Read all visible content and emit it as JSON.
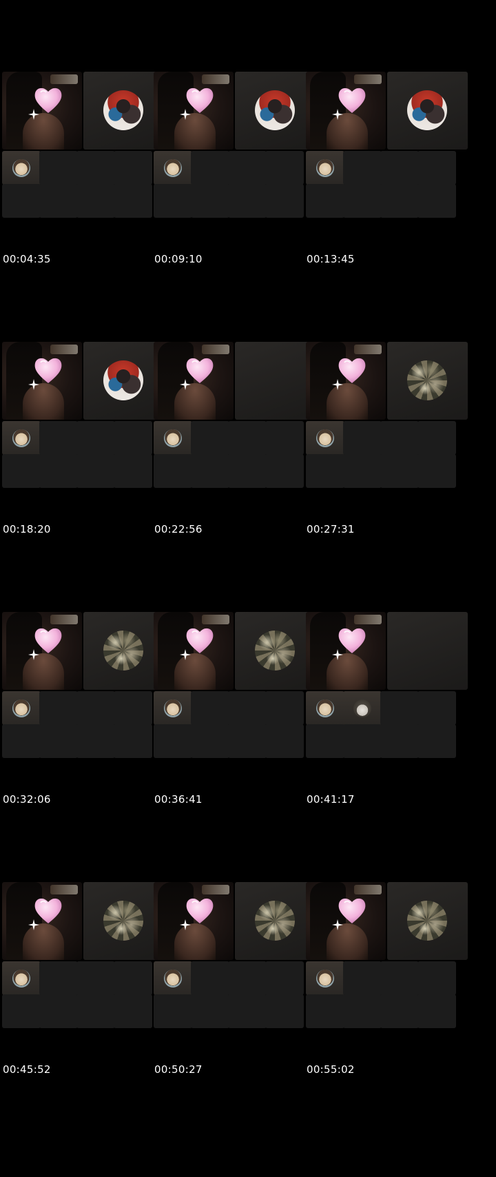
{
  "sheet": {
    "timestamps": [
      "00:04:35",
      "00:09:10",
      "00:13:45",
      "00:18:20",
      "00:22:56",
      "00:27:31",
      "00:32:06",
      "00:36:41",
      "00:41:17",
      "00:45:52",
      "00:50:27",
      "00:55:02"
    ],
    "frames": [
      {
        "guest_avatar": "red-jacket-avatar",
        "extra_seat_avatar": ""
      },
      {
        "guest_avatar": "red-jacket-avatar",
        "extra_seat_avatar": ""
      },
      {
        "guest_avatar": "red-jacket-avatar",
        "extra_seat_avatar": ""
      },
      {
        "guest_avatar": "red-jacket-avatar",
        "extra_seat_avatar": ""
      },
      {
        "guest_avatar": "",
        "extra_seat_avatar": ""
      },
      {
        "guest_avatar": "moss-pattern-avatar",
        "extra_seat_avatar": ""
      },
      {
        "guest_avatar": "moss-pattern-avatar",
        "extra_seat_avatar": ""
      },
      {
        "guest_avatar": "moss-pattern-avatar",
        "extra_seat_avatar": ""
      },
      {
        "guest_avatar": "",
        "extra_seat_avatar": "dog-avatar"
      },
      {
        "guest_avatar": "moss-pattern-avatar",
        "extra_seat_avatar": ""
      },
      {
        "guest_avatar": "moss-pattern-avatar",
        "extra_seat_avatar": ""
      },
      {
        "guest_avatar": "moss-pattern-avatar",
        "extra_seat_avatar": ""
      }
    ],
    "colors": {
      "background": "#000000",
      "tile": "#1c1c1c",
      "timestamp_text": "#ffffff",
      "heart_sticker": "#f3b3dc"
    },
    "icons": {
      "heart": "heart-sticker-icon",
      "sparkle": "sparkle-icon"
    }
  }
}
